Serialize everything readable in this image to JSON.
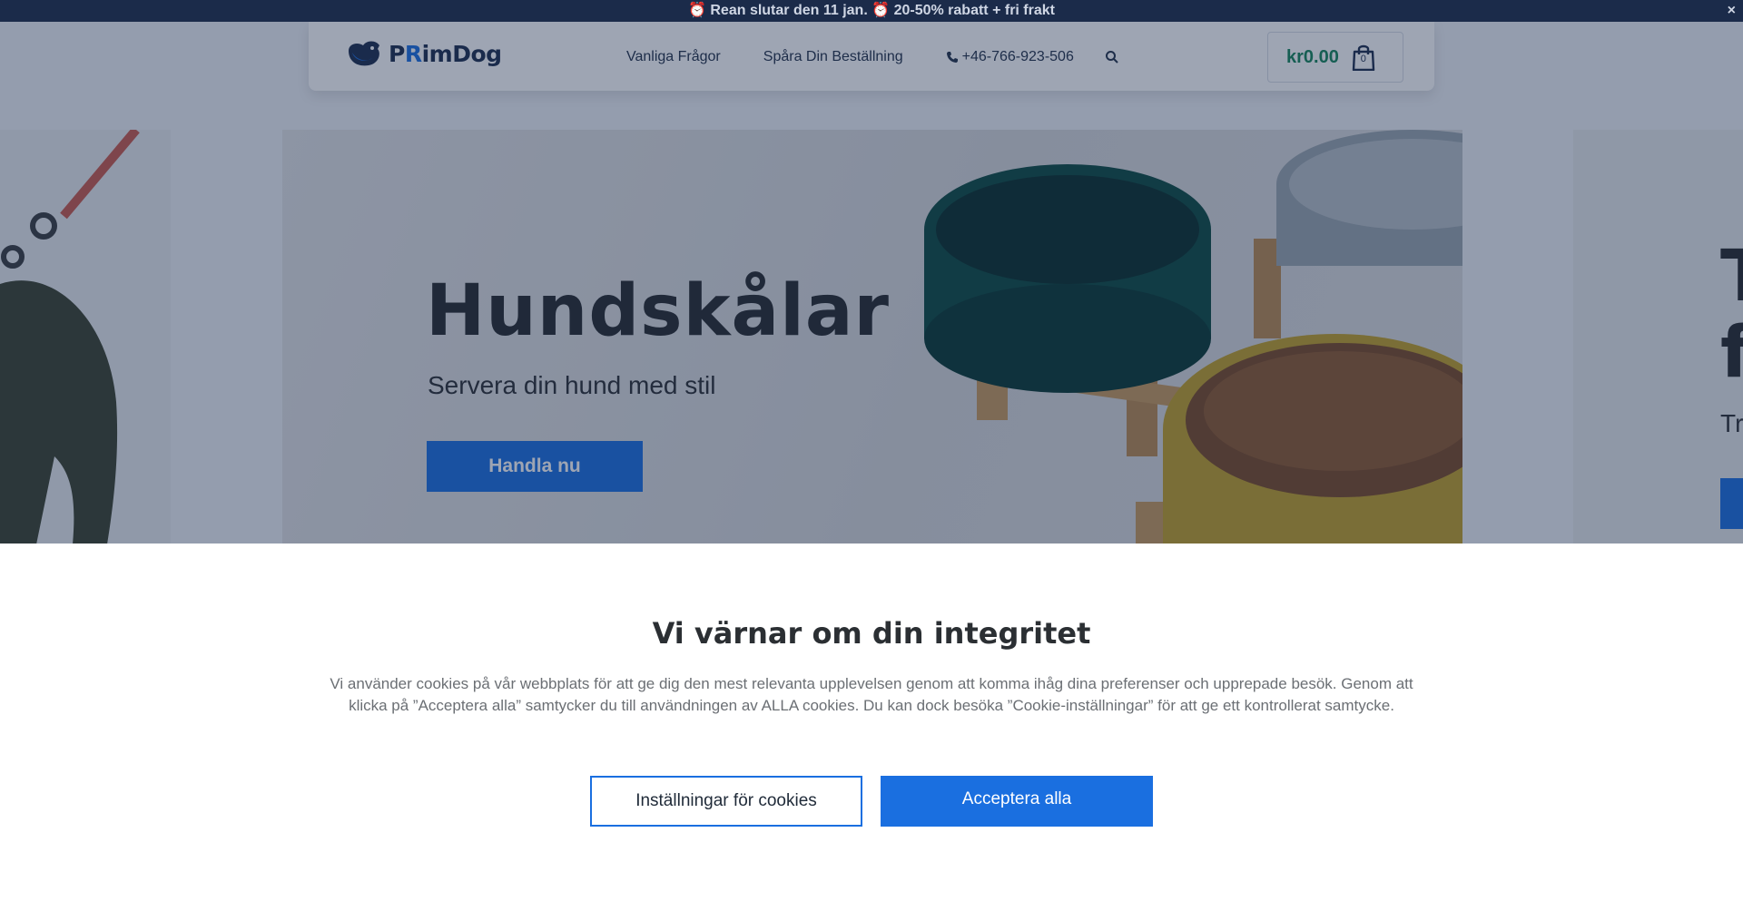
{
  "announcement": {
    "text": "⏰ Rean slutar den 11 jan. ⏰ 20-50% rabatt + fri frakt",
    "close_label": "×"
  },
  "header": {
    "logo_prefix": "P",
    "logo_r": "R",
    "logo_suffix": "imDog",
    "nav": {
      "faq": "Vanliga Frågor",
      "track": "Spåra Din Beställning",
      "phone": "+46-766-923-506"
    },
    "cart": {
      "total": "kr0.00",
      "count": "0"
    }
  },
  "hero": {
    "title": "Hundskålar",
    "subtitle": "Servera din hund med stil",
    "cta": "Handla nu",
    "next_title": "T\nf",
    "next_sub": "Tr"
  },
  "cookie": {
    "title": "Vi värnar om din integritet",
    "body": "Vi använder cookies på vår webbplats för att ge dig den mest relevanta upplevelsen genom att komma ihåg dina preferenser och upprepade besök. Genom att klicka på ”Acceptera alla” samtycker du till användningen av ALLA cookies. Du kan dock besöka ”Cookie-inställningar” för att ge ett kontrollerat samtycke.",
    "settings_label": "Inställningar för cookies",
    "accept_label": "Acceptera alla"
  },
  "colors": {
    "accent": "#1a6fe0",
    "announce_bg": "#1b2b4a",
    "price": "#16865a"
  },
  "icons": [
    "phone-icon",
    "search-icon",
    "shopping-bag-icon",
    "close-icon"
  ]
}
